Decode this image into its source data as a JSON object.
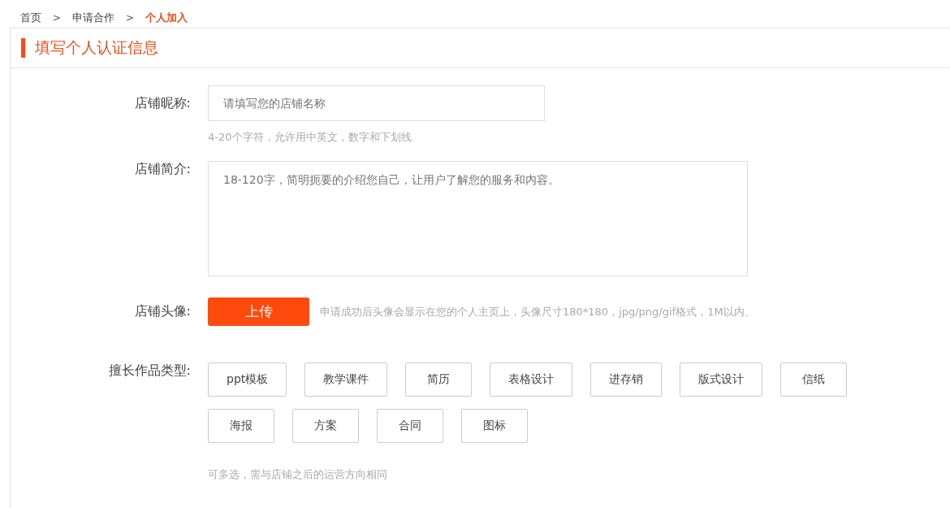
{
  "breadcrumb": [
    {
      "label": "首页",
      "selected": false
    },
    {
      "label": "申请合作",
      "selected": false
    },
    {
      "label": "个人加入",
      "selected": true
    }
  ],
  "breadcrumb_separator": ">",
  "section_title": "填写个人认证信息",
  "form": {
    "nickname": {
      "label": "店铺昵称:",
      "placeholder": "请填写您的店铺名称",
      "hint": "4-20个字符，允许用中英文，数字和下划线"
    },
    "intro": {
      "label": "店铺简介:",
      "placeholder": "18-120字，简明扼要的介绍您自己，让用户了解您的服务和内容。"
    },
    "avatar": {
      "label": "店铺头像:",
      "button": "上传",
      "hint": "申请成功后头像会显示在您的个人主页上，头像尺寸180*180，jpg/png/gif格式，1M以内。"
    },
    "types": {
      "label": "擅长作品类型:",
      "options": [
        {
          "label": "ppt模板",
          "selected": false
        },
        {
          "label": "教学课件",
          "selected": false
        },
        {
          "label": "简历",
          "selected": false
        },
        {
          "label": "表格设计",
          "selected": false
        },
        {
          "label": "进存销",
          "selected": false
        },
        {
          "label": "版式设计",
          "selected": false
        },
        {
          "label": "信纸",
          "selected": false
        },
        {
          "label": "海报",
          "selected": false
        },
        {
          "label": "方案",
          "selected": false
        },
        {
          "label": "合同",
          "selected": false
        },
        {
          "label": "图标",
          "selected": false
        }
      ],
      "hint": "可多选，需与店铺之后的运营方向相同"
    }
  }
}
